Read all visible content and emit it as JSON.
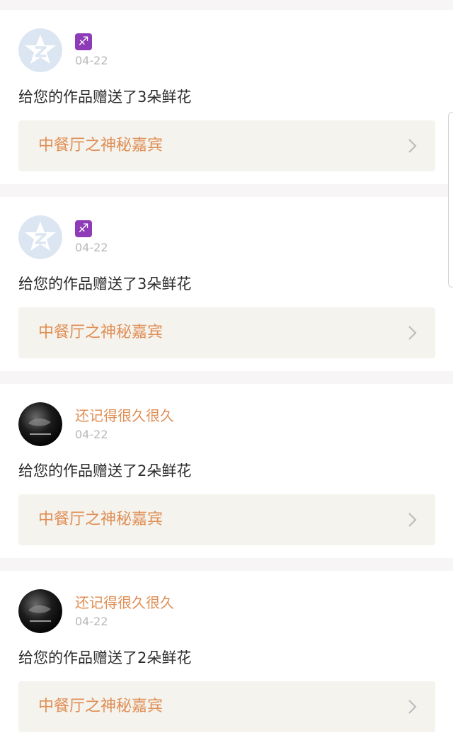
{
  "notifications": [
    {
      "avatar": "qq-default-avatar",
      "sender": "",
      "zodiac_icon": "sagittarius-icon",
      "zodiac_symbol": "♐",
      "date": "04-22",
      "message": "给您的作品赠送了3朵鲜花",
      "work_title": "中餐厅之神秘嘉宾"
    },
    {
      "avatar": "qq-default-avatar",
      "sender": "",
      "zodiac_icon": "sagittarius-icon",
      "zodiac_symbol": "♐",
      "date": "04-22",
      "message": "给您的作品赠送了3朵鲜花",
      "work_title": "中餐厅之神秘嘉宾"
    },
    {
      "avatar": "dark-photo-avatar",
      "sender": "还记得很久很久",
      "date": "04-22",
      "message": "给您的作品赠送了2朵鲜花",
      "work_title": "中餐厅之神秘嘉宾"
    },
    {
      "avatar": "dark-photo-avatar",
      "sender": "还记得很久很久",
      "date": "04-22",
      "message": "给您的作品赠送了2朵鲜花",
      "work_title": "中餐厅之神秘嘉宾"
    }
  ],
  "colors": {
    "accent": "#e08e54",
    "text": "#2b2b2b",
    "muted": "#b8b8b8",
    "link_bg": "#f4f3ee",
    "page_bg": "#f7f5f5"
  }
}
